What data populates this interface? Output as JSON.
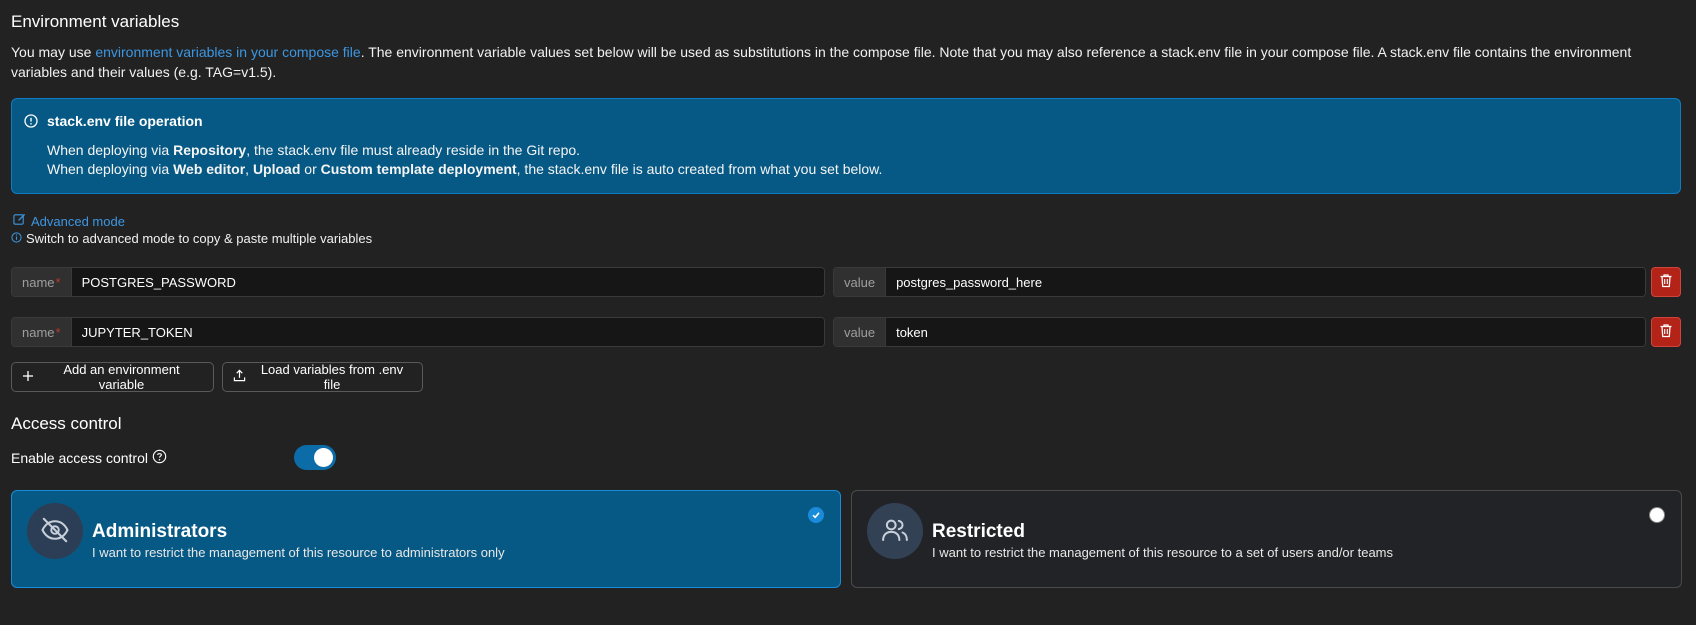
{
  "env": {
    "title": "Environment variables",
    "intro_before": "You may use ",
    "intro_link": "environment variables in your compose file",
    "intro_after": ". The environment variable values set below will be used as substitutions in the compose file. Note that you may also reference a stack.env file in your compose file. A stack.env file contains the environment variables and their values (e.g. TAG=v1.5).",
    "info": {
      "title": "stack.env file operation",
      "l1_a": "When deploying via ",
      "l1_b": "Repository",
      "l1_c": ", the stack.env file must already reside in the Git repo.",
      "l2_a": "When deploying via ",
      "l2_b": "Web editor",
      "l2_c": ", ",
      "l2_d": "Upload",
      "l2_e": " or ",
      "l2_f": "Custom template deployment",
      "l2_g": ", the stack.env file is auto created from what you set below."
    },
    "advanced_link": "Advanced mode",
    "advanced_hint": "Switch to advanced mode to copy & paste multiple variables",
    "name_label": "name",
    "required_mark": "*",
    "value_label": "value",
    "variables": [
      {
        "name": "POSTGRES_PASSWORD",
        "value": "postgres_password_here"
      },
      {
        "name": "JUPYTER_TOKEN",
        "value": "token"
      }
    ],
    "add_button": "Add an environment variable",
    "load_button": "Load variables from .env file"
  },
  "access": {
    "title": "Access control",
    "enable_label": "Enable access control",
    "enabled": true,
    "options": [
      {
        "title": "Administrators",
        "description": "I want to restrict the management of this resource to administrators only",
        "selected": true
      },
      {
        "title": "Restricted",
        "description": "I want to restrict the management of this resource to a set of users and/or teams",
        "selected": false
      }
    ]
  },
  "colors": {
    "background": "#222222",
    "info_bg": "#075985",
    "link": "#3b97e3",
    "danger": "#b42318",
    "toggle_on": "#0c6ca8"
  }
}
